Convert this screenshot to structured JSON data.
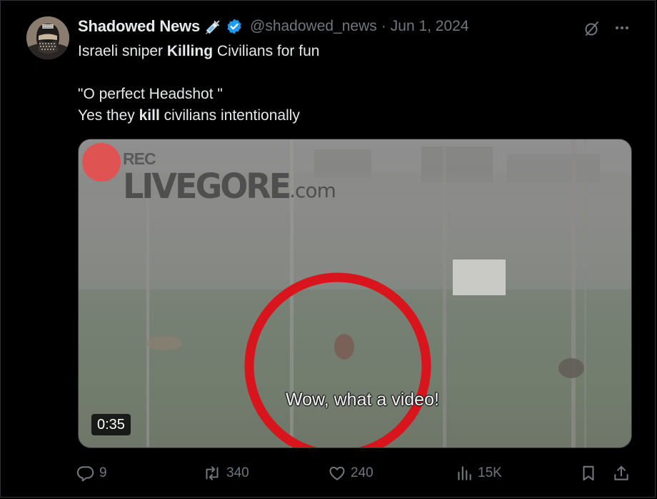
{
  "tweet": {
    "author_name": "Shadowed News",
    "handle": "@shadowed_news",
    "separator": "·",
    "date": "Jun 1, 2024",
    "text_line1": {
      "pre": "Israeli sniper ",
      "bold": "Killing",
      "post": " Civilians for fun"
    },
    "text_line2": "\"O perfect Headshot \"",
    "text_line3": {
      "pre": "Yes they ",
      "bold": "kill",
      "post": " civilians intentionally"
    }
  },
  "media": {
    "rec_label": "REC",
    "watermark_main": "LIVEGORE",
    "watermark_suffix": ".com",
    "caption": "Wow, what a video!",
    "duration": "0:35"
  },
  "actions": {
    "replies": "9",
    "reposts": "340",
    "likes": "240",
    "views": "15K"
  },
  "colors": {
    "background": "#000000",
    "text_primary": "#e7e9ea",
    "text_secondary": "#71767b",
    "verified": "#1d9bf0",
    "rec_dot": "#e05353",
    "circle_annotation": "#d8141c"
  },
  "icons": {
    "emoji": "syringe-icon",
    "verified": "verified-badge-icon",
    "grok": "grok-icon",
    "more": "more-icon",
    "reply": "reply-icon",
    "repost": "repost-icon",
    "like": "like-icon",
    "views": "views-icon",
    "bookmark": "bookmark-icon",
    "share": "share-icon"
  }
}
